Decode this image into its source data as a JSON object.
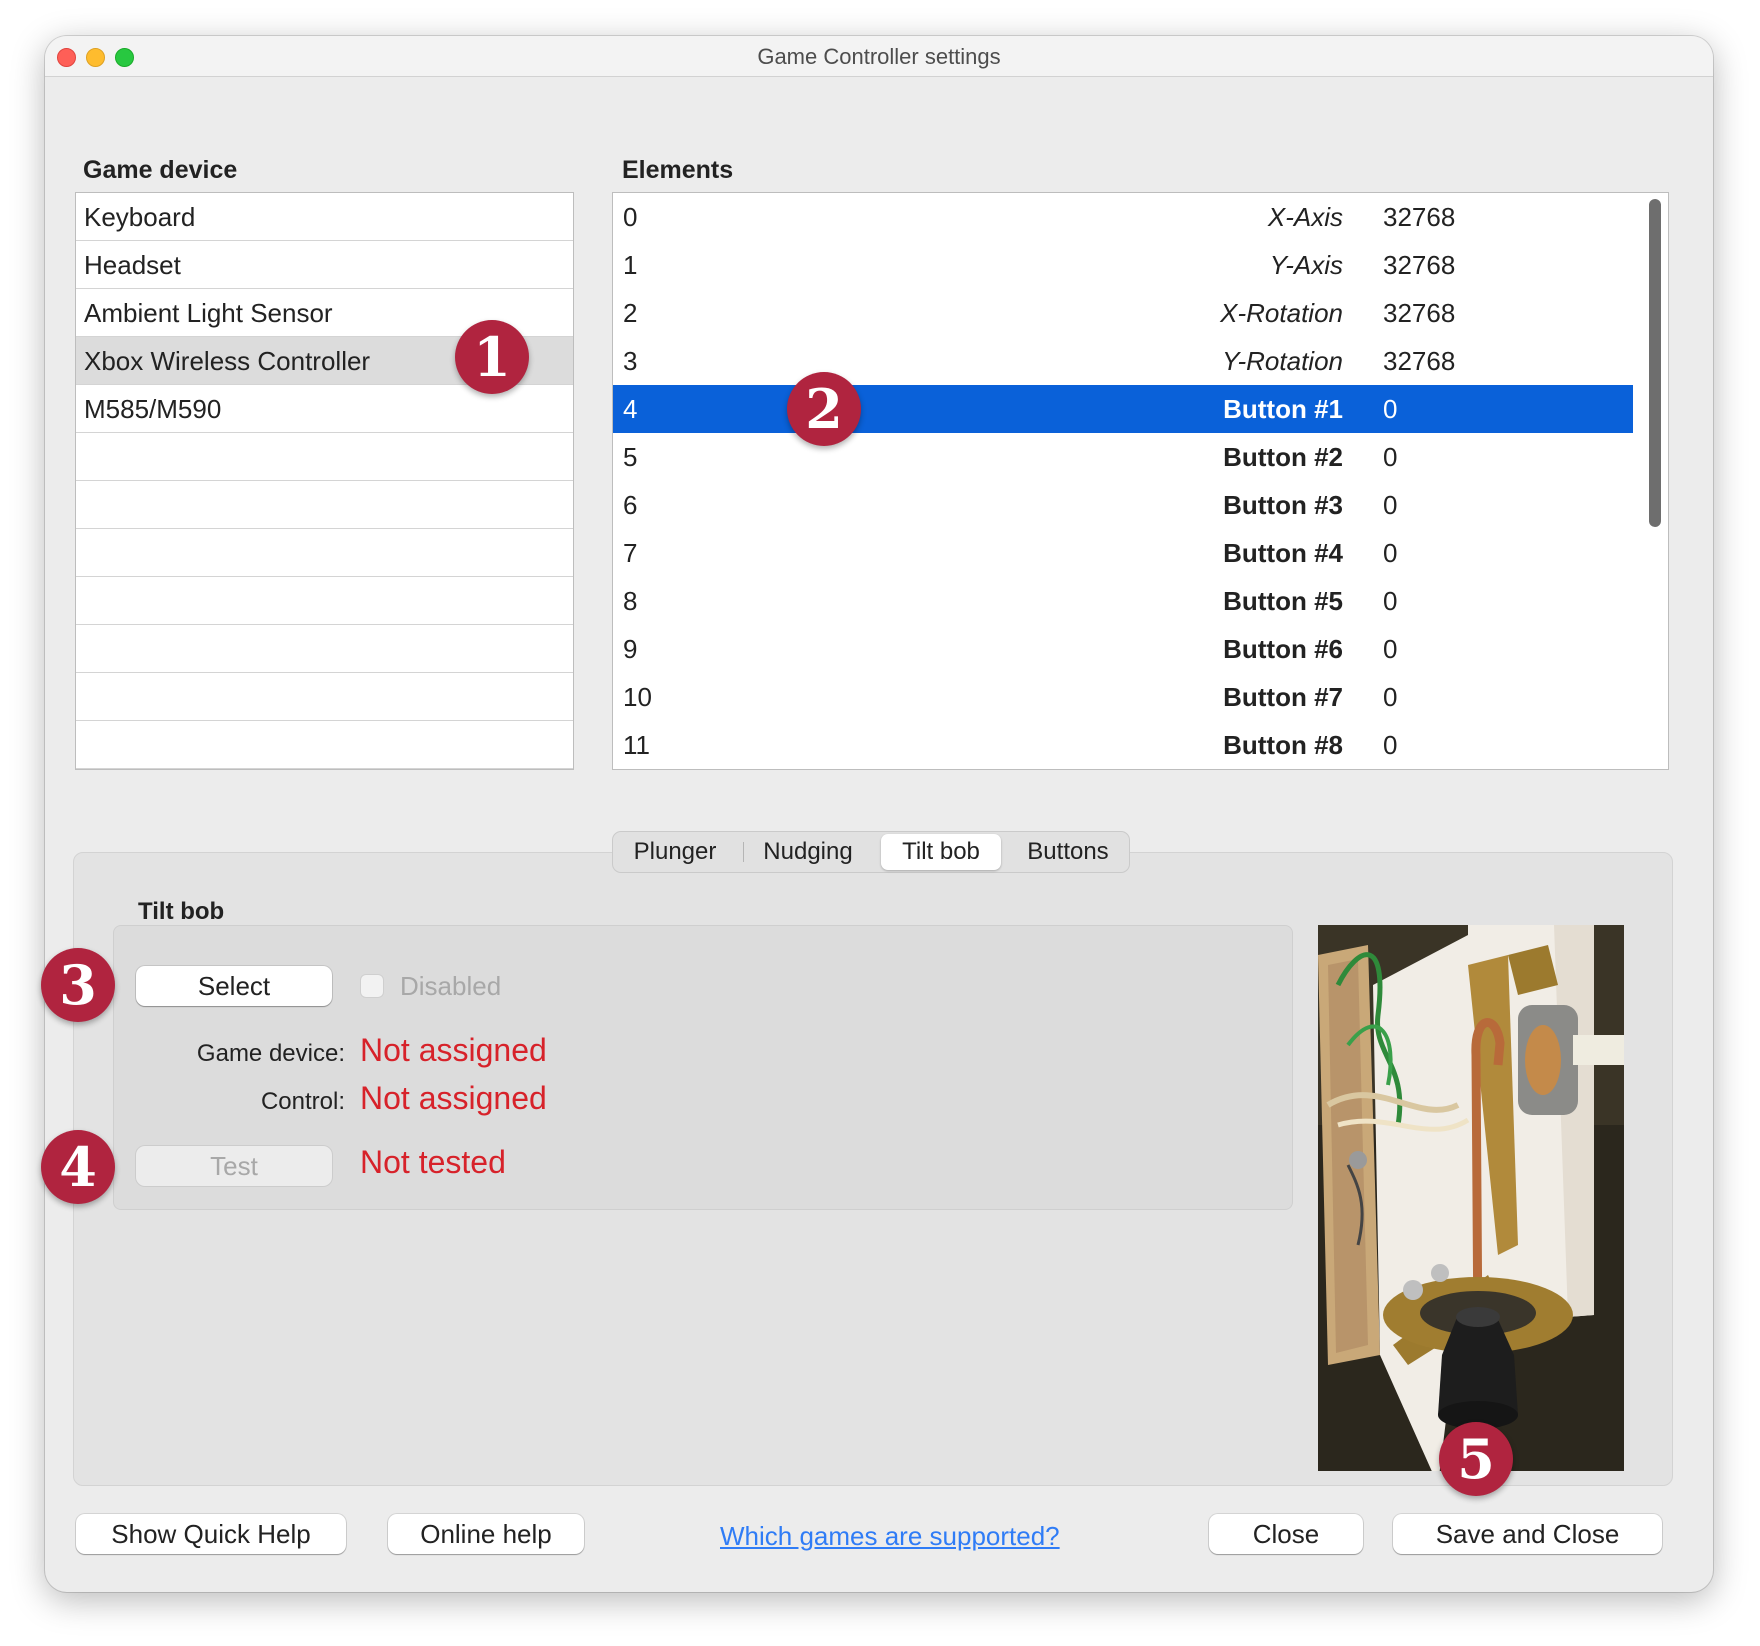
{
  "window": {
    "title": "Game Controller settings"
  },
  "game_device": {
    "label": "Game device",
    "items": [
      "Keyboard",
      "Headset",
      "Ambient Light Sensor",
      "Xbox Wireless Controller",
      "M585/M590",
      "",
      "",
      "",
      "",
      "",
      "",
      ""
    ],
    "selected_index": 3
  },
  "elements": {
    "label": "Elements",
    "rows": [
      {
        "index": "0",
        "name": "X-Axis",
        "value": "32768"
      },
      {
        "index": "1",
        "name": "Y-Axis",
        "value": "32768"
      },
      {
        "index": "2",
        "name": "X-Rotation",
        "value": "32768"
      },
      {
        "index": "3",
        "name": "Y-Rotation",
        "value": "32768"
      },
      {
        "index": "4",
        "name": "Button #1",
        "value": "0"
      },
      {
        "index": "5",
        "name": "Button #2",
        "value": "0"
      },
      {
        "index": "6",
        "name": "Button #3",
        "value": "0"
      },
      {
        "index": "7",
        "name": "Button #4",
        "value": "0"
      },
      {
        "index": "8",
        "name": "Button #5",
        "value": "0"
      },
      {
        "index": "9",
        "name": "Button #6",
        "value": "0"
      },
      {
        "index": "10",
        "name": "Button #7",
        "value": "0"
      },
      {
        "index": "11",
        "name": "Button #8",
        "value": "0"
      }
    ],
    "selected_index": 4
  },
  "tabs": [
    "Plunger",
    "Nudging",
    "Tilt bob",
    "Buttons"
  ],
  "active_tab": "Tilt bob",
  "tilt_bob": {
    "label": "Tilt bob",
    "select_button": "Select",
    "disabled_label": "Disabled",
    "disabled_checked": false,
    "game_device_label": "Game device:",
    "game_device_value": "Not assigned",
    "control_label": "Control:",
    "control_value": "Not assigned",
    "test_button": "Test",
    "test_status": "Not tested"
  },
  "footer": {
    "quick_help": "Show Quick Help",
    "online_help": "Online help",
    "supported_link": "Which games are supported?",
    "close": "Close",
    "save_close": "Save and Close"
  },
  "callouts": [
    "1",
    "2",
    "3",
    "4",
    "5"
  ],
  "colors": {
    "accent": "#0a61d9",
    "status_red": "#d7222a",
    "badge": "#b0243f",
    "link": "#2f7cf6"
  }
}
